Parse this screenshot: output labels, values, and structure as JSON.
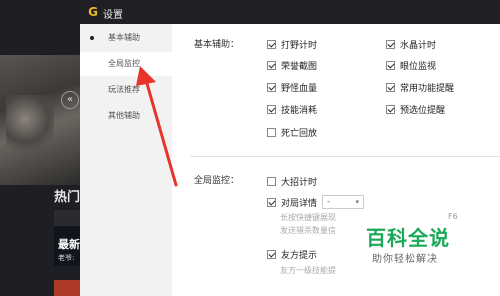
{
  "background": {
    "hot_label": "热门",
    "latest_label": "最新",
    "author_label": "老爷:"
  },
  "window": {
    "title": "设置"
  },
  "sidebar": {
    "items": [
      {
        "label": "基本辅助",
        "active": false
      },
      {
        "label": "全局监控",
        "active": true
      },
      {
        "label": "玩法推荐",
        "active": false
      },
      {
        "label": "其他辅助",
        "active": false
      }
    ]
  },
  "basic": {
    "section_label": "基本辅助：",
    "left_options": [
      {
        "label": "打野计时",
        "checked": true
      },
      {
        "label": "荣誉截图",
        "checked": true
      },
      {
        "label": "野怪血量",
        "checked": true
      },
      {
        "label": "技能消耗",
        "checked": true
      },
      {
        "label": "死亡回放",
        "checked": false
      }
    ],
    "right_options": [
      {
        "label": "水晶计时",
        "checked": true
      },
      {
        "label": "眼位监视",
        "checked": true
      },
      {
        "label": "常用功能提醒",
        "checked": true
      },
      {
        "label": "预选位提醒",
        "checked": true
      }
    ]
  },
  "global": {
    "section_label": "全局监控：",
    "options": [
      {
        "label": "大招计时",
        "checked": false
      },
      {
        "label": "对局详情",
        "checked": true
      },
      {
        "label": "友方提示",
        "checked": true
      }
    ],
    "dropdown_value": "-",
    "desc_lines": [
      "长按快捷键展现",
      "发送猎杀数量信"
    ],
    "desc_right": "F6",
    "friend_desc": "友方一级技能提"
  },
  "watermark": {
    "main": "百科全说",
    "sub": "助你轻松解决"
  },
  "colors": {
    "annotation_arrow": "#e8352b",
    "watermark_green": "#1aa85a",
    "logo_gold": "#e8b923"
  }
}
